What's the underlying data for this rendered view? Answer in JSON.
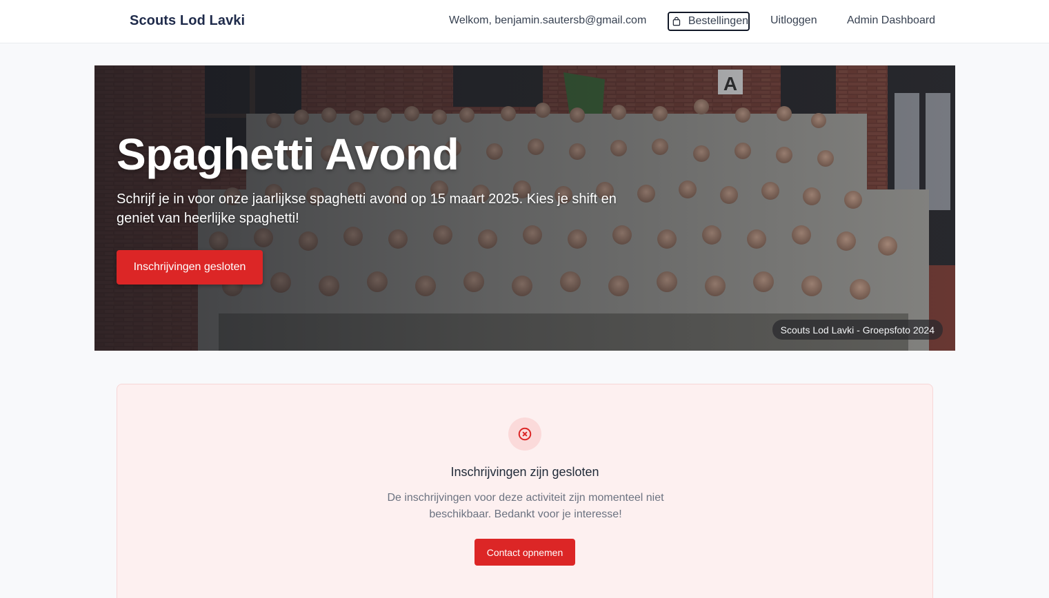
{
  "navbar": {
    "brand": "Scouts Lod Lavki",
    "welcome": "Welkom, benjamin.sautersb@gmail.com",
    "orders_label": "Bestellingen",
    "orders_icon": "shopping-bag-icon",
    "logout_label": "Uitloggen",
    "admin_label": "Admin Dashboard"
  },
  "hero": {
    "title": "Spaghetti Avond",
    "subtitle": "Schrijf je in voor onze jaarlijkse spaghetti avond op 15 maart 2025. Kies je shift en geniet van heerlijke spaghetti!",
    "button_label": "Inschrijvingen gesloten",
    "image_caption": "Scouts Lod Lavki - Groepsfoto 2024",
    "banner_letter": "A"
  },
  "closed": {
    "icon": "x-circle-icon",
    "title": "Inschrijvingen zijn gesloten",
    "text": "De inschrijvingen voor deze activiteit zijn momenteel niet beschikbaar. Bedankt voor je interesse!",
    "contact_label": "Contact opnemen"
  },
  "colors": {
    "accent_red": "#dc2626",
    "brand_navy": "#1e2a4a",
    "closed_bg": "#fdf0f0"
  }
}
